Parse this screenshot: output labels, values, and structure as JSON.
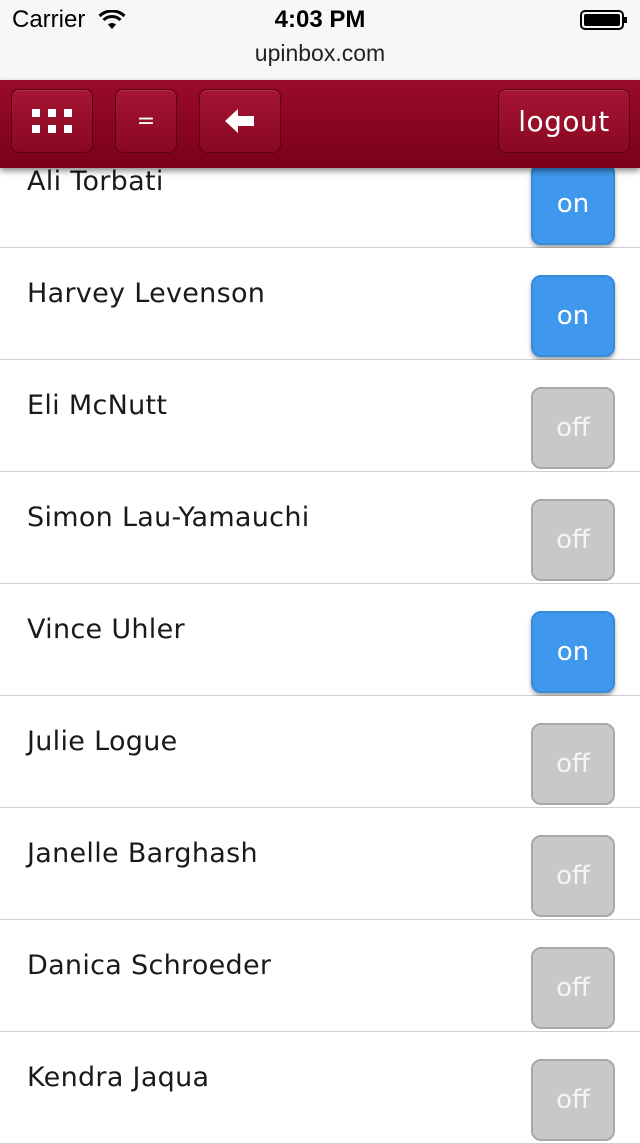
{
  "status_bar": {
    "carrier": "Carrier",
    "time": "4:03 PM",
    "url": "upinbox.com",
    "wifi_icon": "wifi-icon",
    "battery_icon": "battery-icon"
  },
  "toolbar": {
    "apps_icon": "grid-icon",
    "menu_label": "=",
    "back_icon": "arrow-left-icon",
    "logout_label": "logout",
    "background_color": "#8b0a24"
  },
  "colors": {
    "on": "#3f97ee",
    "off": "#c8c8c8"
  },
  "contacts": [
    {
      "name": "Ali Torbati",
      "status": "on"
    },
    {
      "name": "Harvey Levenson",
      "status": "on"
    },
    {
      "name": "Eli McNutt",
      "status": "off"
    },
    {
      "name": "Simon Lau-Yamauchi",
      "status": "off"
    },
    {
      "name": "Vince Uhler",
      "status": "on"
    },
    {
      "name": "Julie Logue",
      "status": "off"
    },
    {
      "name": "Janelle Barghash",
      "status": "off"
    },
    {
      "name": "Danica Schroeder",
      "status": "off"
    },
    {
      "name": "Kendra Jaqua",
      "status": "off"
    }
  ]
}
